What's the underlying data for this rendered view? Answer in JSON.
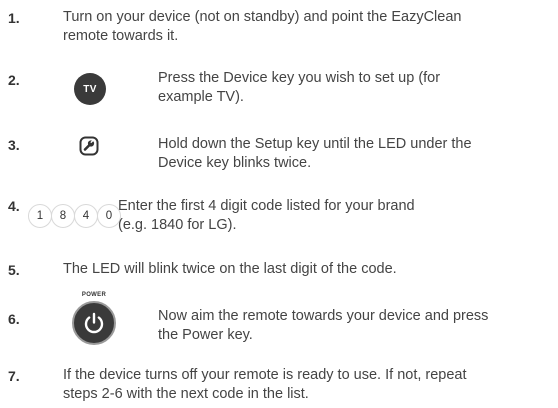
{
  "steps": [
    {
      "number": "1.",
      "lines": [
        "Turn on your device (not on standby) and point the EazyClean",
        "remote towards it."
      ]
    },
    {
      "number": "2.",
      "icon_label": "TV",
      "lines": [
        "Press the Device key you wish to set up (for",
        "example TV)."
      ]
    },
    {
      "number": "3.",
      "icon": "setup-wrench-icon",
      "lines": [
        "Hold down the Setup key until the LED under the",
        "Device key blinks twice."
      ]
    },
    {
      "number": "4.",
      "digits": [
        "1",
        "8",
        "4",
        "0"
      ],
      "lines": [
        "Enter the first 4 digit code listed for your brand",
        "(e.g. 1840 for LG)."
      ]
    },
    {
      "number": "5.",
      "lines": [
        "The LED will blink twice on the last digit of the code."
      ]
    },
    {
      "number": "6.",
      "icon_label": "POWER",
      "icon": "power-icon",
      "lines": [
        "Now aim the remote towards your device and press",
        "the Power key."
      ]
    },
    {
      "number": "7.",
      "lines": [
        "If the device turns off your remote is ready to use. If not, repeat",
        "steps 2-6 with the next code in the list."
      ]
    }
  ],
  "colors": {
    "text": "#444444",
    "button": "#3a3a3a"
  }
}
